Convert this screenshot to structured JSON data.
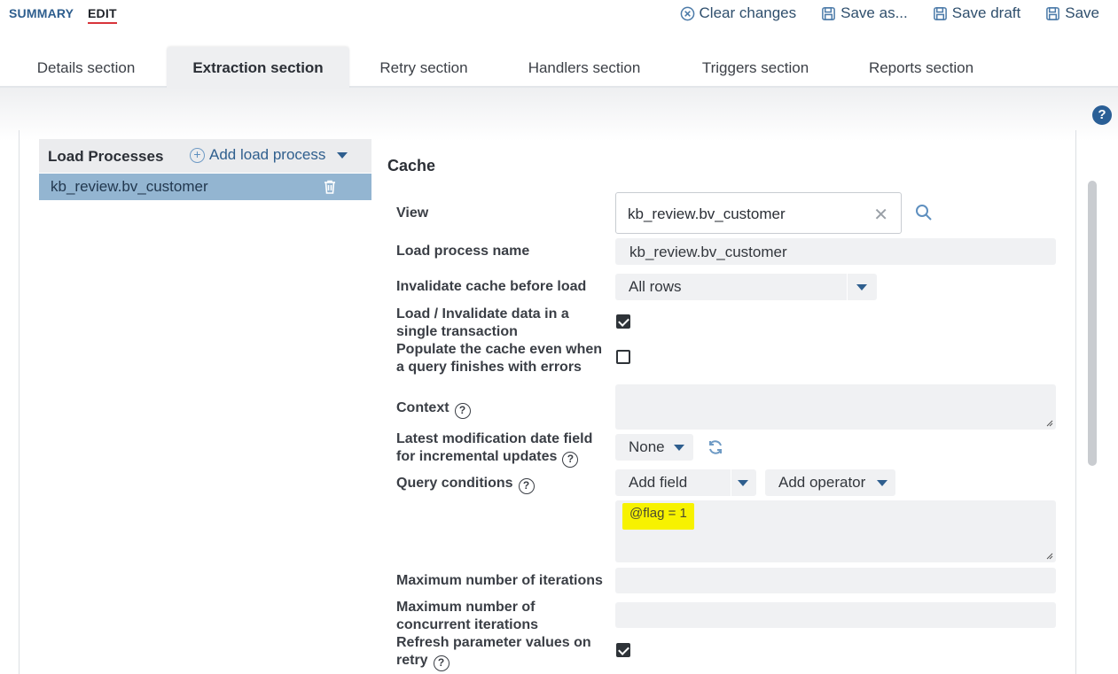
{
  "modes": {
    "summary": "SUMMARY",
    "edit": "EDIT"
  },
  "actions": {
    "clear": "Clear changes",
    "save_as": "Save as...",
    "save_draft": "Save draft",
    "save": "Save"
  },
  "tabs": [
    {
      "label": "Details section"
    },
    {
      "label": "Extraction section",
      "active": true
    },
    {
      "label": "Retry section"
    },
    {
      "label": "Handlers section"
    },
    {
      "label": "Triggers section"
    },
    {
      "label": "Reports section"
    }
  ],
  "help_glyph": "?",
  "load_processes": {
    "title": "Load Processes",
    "add_label": "Add load process",
    "items": [
      {
        "label": "kb_review.bv_customer",
        "selected": true
      }
    ]
  },
  "cache": {
    "title": "Cache",
    "view": {
      "label": "View",
      "value": "kb_review.bv_customer",
      "clear_glyph": "✕"
    },
    "load_process_name": {
      "label": "Load process name",
      "value": "kb_review.bv_customer"
    },
    "invalidate": {
      "label": "Invalidate cache before load",
      "value": "All rows"
    },
    "single_transaction": {
      "label_line1": "Load / Invalidate data in a",
      "label_line2": "single transaction",
      "checked": true
    },
    "populate_errors": {
      "label_line1": "Populate the cache even when",
      "label_line2": "a query finishes with errors",
      "checked": false
    },
    "context": {
      "label": "Context",
      "value": ""
    },
    "latest_mod": {
      "label_line1": "Latest modification date field",
      "label_line2": "for incremental updates",
      "value": "None"
    },
    "query_conditions": {
      "label": "Query conditions",
      "add_field": "Add field",
      "add_operator": "Add operator",
      "value": "@flag = 1"
    },
    "max_iterations": {
      "label": "Maximum number of iterations",
      "value": ""
    },
    "max_concurrent": {
      "label_line1": "Maximum number of",
      "label_line2": "concurrent iterations",
      "value": ""
    },
    "refresh_params": {
      "label_line1": "Refresh parameter values on",
      "label_line2": "retry",
      "checked": true
    }
  },
  "colors": {
    "accent": "#2e5e8e",
    "edit_underline": "#d8343a",
    "selected_row": "#93b5d1",
    "highlight": "#f7f200"
  }
}
